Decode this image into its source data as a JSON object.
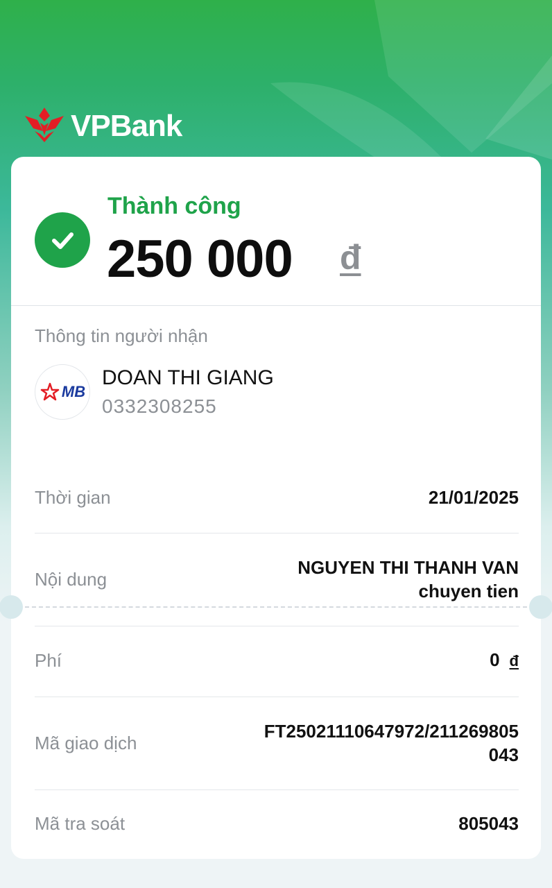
{
  "brand": {
    "name": "VPBank",
    "icon": "vpbank-logo-icon"
  },
  "transaction": {
    "status": "Thành công",
    "amount": "250 000",
    "currency_symbol": "đ",
    "status_icon": "check-circle-icon"
  },
  "recipient": {
    "section_label": "Thông tin người nhận",
    "bank_logo_text": "MB",
    "bank_icon": "mb-bank-logo-icon",
    "name": "DOAN THI GIANG",
    "account": "0332308255"
  },
  "details": {
    "time_label": "Thời gian",
    "time_value": "21/01/2025",
    "content_label": "Nội dung",
    "content_line1": "NGUYEN THI THANH VAN",
    "content_line2": "chuyen tien",
    "fee_label": "Phí",
    "fee_value": "0",
    "fee_currency": "đ",
    "txid_label": "Mã giao dịch",
    "txid_line1": "FT25021110647972/211269805",
    "txid_line2": "043",
    "trace_label": "Mã tra soát",
    "trace_value": "805043"
  },
  "colors": {
    "success_green": "#1fa34a",
    "brand_red": "#e31e25",
    "background_top": "#2fb04a",
    "background_bottom": "#eef4f6"
  }
}
